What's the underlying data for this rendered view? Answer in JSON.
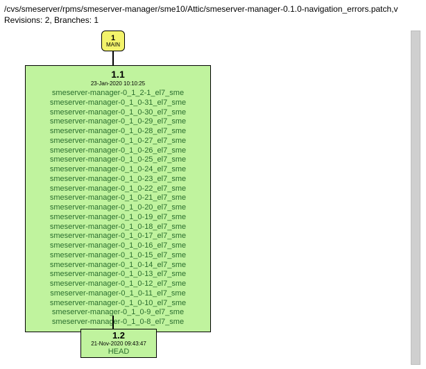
{
  "header": {
    "path": "/cvs/smeserver/rpms/smeserver-manager/sme10/Attic/smeserver-manager-0.1.0-navigation_errors.patch,v",
    "rev_line": "Revisions: 2, Branches: 1"
  },
  "main_branch": {
    "num": "1",
    "label": "MAIN"
  },
  "node_1_1": {
    "version": "1.1",
    "timestamp": "23-Jan-2020 10:10:25",
    "tags": [
      "smeserver-manager-0_1_2-1_el7_sme",
      "smeserver-manager-0_1_0-31_el7_sme",
      "smeserver-manager-0_1_0-30_el7_sme",
      "smeserver-manager-0_1_0-29_el7_sme",
      "smeserver-manager-0_1_0-28_el7_sme",
      "smeserver-manager-0_1_0-27_el7_sme",
      "smeserver-manager-0_1_0-26_el7_sme",
      "smeserver-manager-0_1_0-25_el7_sme",
      "smeserver-manager-0_1_0-24_el7_sme",
      "smeserver-manager-0_1_0-23_el7_sme",
      "smeserver-manager-0_1_0-22_el7_sme",
      "smeserver-manager-0_1_0-21_el7_sme",
      "smeserver-manager-0_1_0-20_el7_sme",
      "smeserver-manager-0_1_0-19_el7_sme",
      "smeserver-manager-0_1_0-18_el7_sme",
      "smeserver-manager-0_1_0-17_el7_sme",
      "smeserver-manager-0_1_0-16_el7_sme",
      "smeserver-manager-0_1_0-15_el7_sme",
      "smeserver-manager-0_1_0-14_el7_sme",
      "smeserver-manager-0_1_0-13_el7_sme",
      "smeserver-manager-0_1_0-12_el7_sme",
      "smeserver-manager-0_1_0-11_el7_sme",
      "smeserver-manager-0_1_0-10_el7_sme",
      "smeserver-manager-0_1_0-9_el7_sme",
      "smeserver-manager-0_1_0-8_el7_sme"
    ]
  },
  "node_1_2": {
    "version": "1.2",
    "timestamp": "21-Nov-2020 09:43:47",
    "tag": "HEAD"
  }
}
